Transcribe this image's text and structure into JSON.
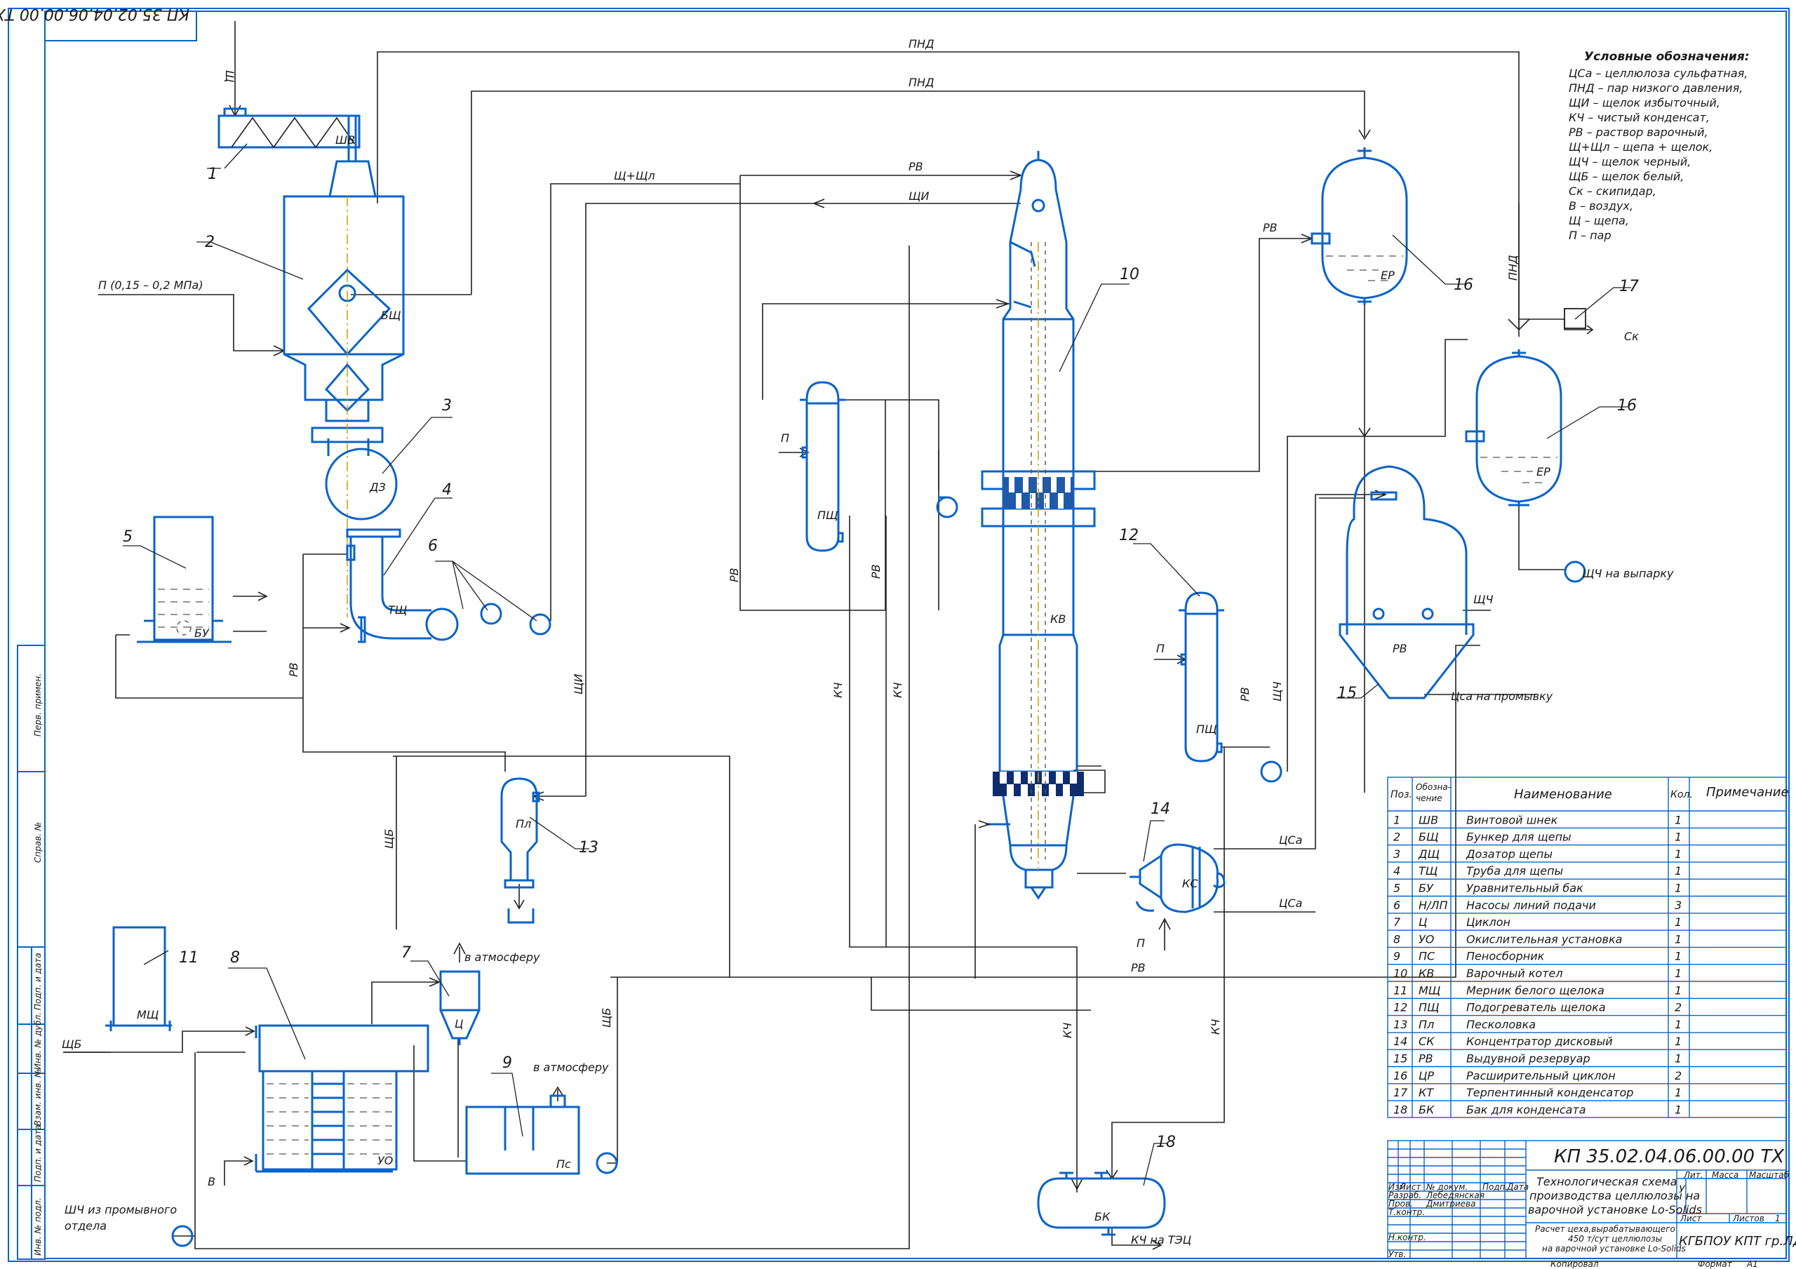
{
  "stamp_top": "КП 35.02.04.06.00.00 ТХ",
  "legend": {
    "title": "Условные обозначения:",
    "items": [
      "ЦСа – целлюлоза сульфатная,",
      "ПНД – пар низкого давления,",
      "ЩИ – щелок избыточный,",
      "КЧ – чистый конденсат,",
      "РВ – раствор варочный,",
      "Щ+Щл – щепа + щелок,",
      "ЩЧ – щелок черный,",
      "ЩБ – щелок белый,",
      "Ск – скипидар,",
      "В – воздух,",
      "Щ – щепа,",
      "П – пар"
    ]
  },
  "flows": {
    "pnd": "ПНД",
    "rv": "РВ",
    "shi": "ЩИ",
    "shshl": "Щ+Щл",
    "kch": "КЧ",
    "shb": "ЩБ",
    "shch": "ЩЧ",
    "tsa": "ЦСа",
    "p": "П",
    "sk": "Ск",
    "sh": "Щ",
    "v": "В",
    "steam_in": "П (0,15 – 0,2 МПа)",
    "to_atm": "в атмосферу",
    "shch_evap": "ЩЧ на выпарку",
    "tsa_wash": "Цса на промывку",
    "kch_tec": "КЧ на ТЭЦ",
    "shch_from_wash_1": "ШЧ из промывного",
    "shch_from_wash_2": "отдела"
  },
  "equipment_labels": {
    "shv": "ШВ",
    "bsh": "БЩ",
    "dsh": "ДЗ",
    "tsh": "ТЩ",
    "bu": "БУ",
    "msh": "МЩ",
    "uo": "УО",
    "ts": "Ц",
    "ps": "Пс",
    "psh": "ПЩ",
    "pl": "Пл",
    "kv": "КВ",
    "ks": "КС",
    "er": "ЕР",
    "rv": "РВ",
    "bk": "БК"
  },
  "positions": [
    "1",
    "2",
    "3",
    "4",
    "5",
    "6",
    "7",
    "8",
    "9",
    "10",
    "11",
    "12",
    "13",
    "14",
    "15",
    "16",
    "16",
    "17",
    "18"
  ],
  "spec_table": {
    "headers": {
      "pos": "Поз.",
      "code_1": "Обозна-",
      "code_2": "чение",
      "name": "Наименование",
      "qty": "Кол.",
      "note": "Примечание"
    },
    "rows": [
      {
        "pos": "1",
        "code": "ШВ",
        "name": "Винтовой шнек",
        "qty": "1"
      },
      {
        "pos": "2",
        "code": "БЩ",
        "name": "Бункер для щепы",
        "qty": "1"
      },
      {
        "pos": "3",
        "code": "ДЩ",
        "name": "Дозатор щепы",
        "qty": "1"
      },
      {
        "pos": "4",
        "code": "ТЩ",
        "name": "Труба для щепы",
        "qty": "1"
      },
      {
        "pos": "5",
        "code": "БУ",
        "name": "Уравнительный бак",
        "qty": "1"
      },
      {
        "pos": "6",
        "code": "Н/ЛП",
        "name": "Насосы линий подачи",
        "qty": "3"
      },
      {
        "pos": "7",
        "code": "Ц",
        "name": "Циклон",
        "qty": "1"
      },
      {
        "pos": "8",
        "code": "УО",
        "name": "Окислительная установка",
        "qty": "1"
      },
      {
        "pos": "9",
        "code": "ПС",
        "name": "Пеносборник",
        "qty": "1"
      },
      {
        "pos": "10",
        "code": "КВ",
        "name": "Варочный котел",
        "qty": "1"
      },
      {
        "pos": "11",
        "code": "МЩ",
        "name": "Мерник белого щелока",
        "qty": "1"
      },
      {
        "pos": "12",
        "code": "ПЩ",
        "name": "Подогреватель щелока",
        "qty": "2"
      },
      {
        "pos": "13",
        "code": "Пл",
        "name": "Песколовка",
        "qty": "1"
      },
      {
        "pos": "14",
        "code": "СК",
        "name": "Концентратор дисковый",
        "qty": "1"
      },
      {
        "pos": "15",
        "code": "РВ",
        "name": "Выдувной резервуар",
        "qty": "1"
      },
      {
        "pos": "16",
        "code": "ЦР",
        "name": "Расширительный циклон",
        "qty": "2"
      },
      {
        "pos": "17",
        "code": "КТ",
        "name": "Терпентинный конденсатор",
        "qty": "1"
      },
      {
        "pos": "18",
        "code": "БК",
        "name": "Бак для конденсата",
        "qty": "1"
      }
    ]
  },
  "title_block": {
    "code": "КП 35.02.04.06.00.00 ТХ",
    "title_1": "Технологическая схема",
    "title_2": "производства целлюлозы на",
    "title_3": "варочной установке Lo-Solids",
    "sub_1": "Расчет цеха,вырабатывающего",
    "sub_2": "450 т/сут целлюлозы",
    "sub_3": "на варочной установке Lo-Solids",
    "org": "КГБПОУ КПТ гр.ЛД 18",
    "cols": {
      "izm": "Изм",
      "list": "Лист",
      "ndok": "№ докум.",
      "podp": "Подп.",
      "data": "Дата"
    },
    "roles": [
      "Разраб.",
      "Пров.",
      "Т.контр.",
      "Н.контр.",
      "Утв."
    ],
    "names": [
      "Лебедянская",
      "Дмитриева"
    ],
    "lit": "Лит.",
    "massa": "Масса",
    "masshtab": "Масштаб",
    "lit_value": "У",
    "sheet": "Лист",
    "sheets": "Листов",
    "sheets_value": "1",
    "kopiroval": "Копировал",
    "format": "Формат",
    "format_value": "А1"
  },
  "side_labels": [
    "Перв. примен.",
    "Справ. №",
    "Подп. и дата",
    "Инв. № дубл.",
    "Взам. инв. №",
    "Подп. и дата",
    "Инв. № подл."
  ]
}
